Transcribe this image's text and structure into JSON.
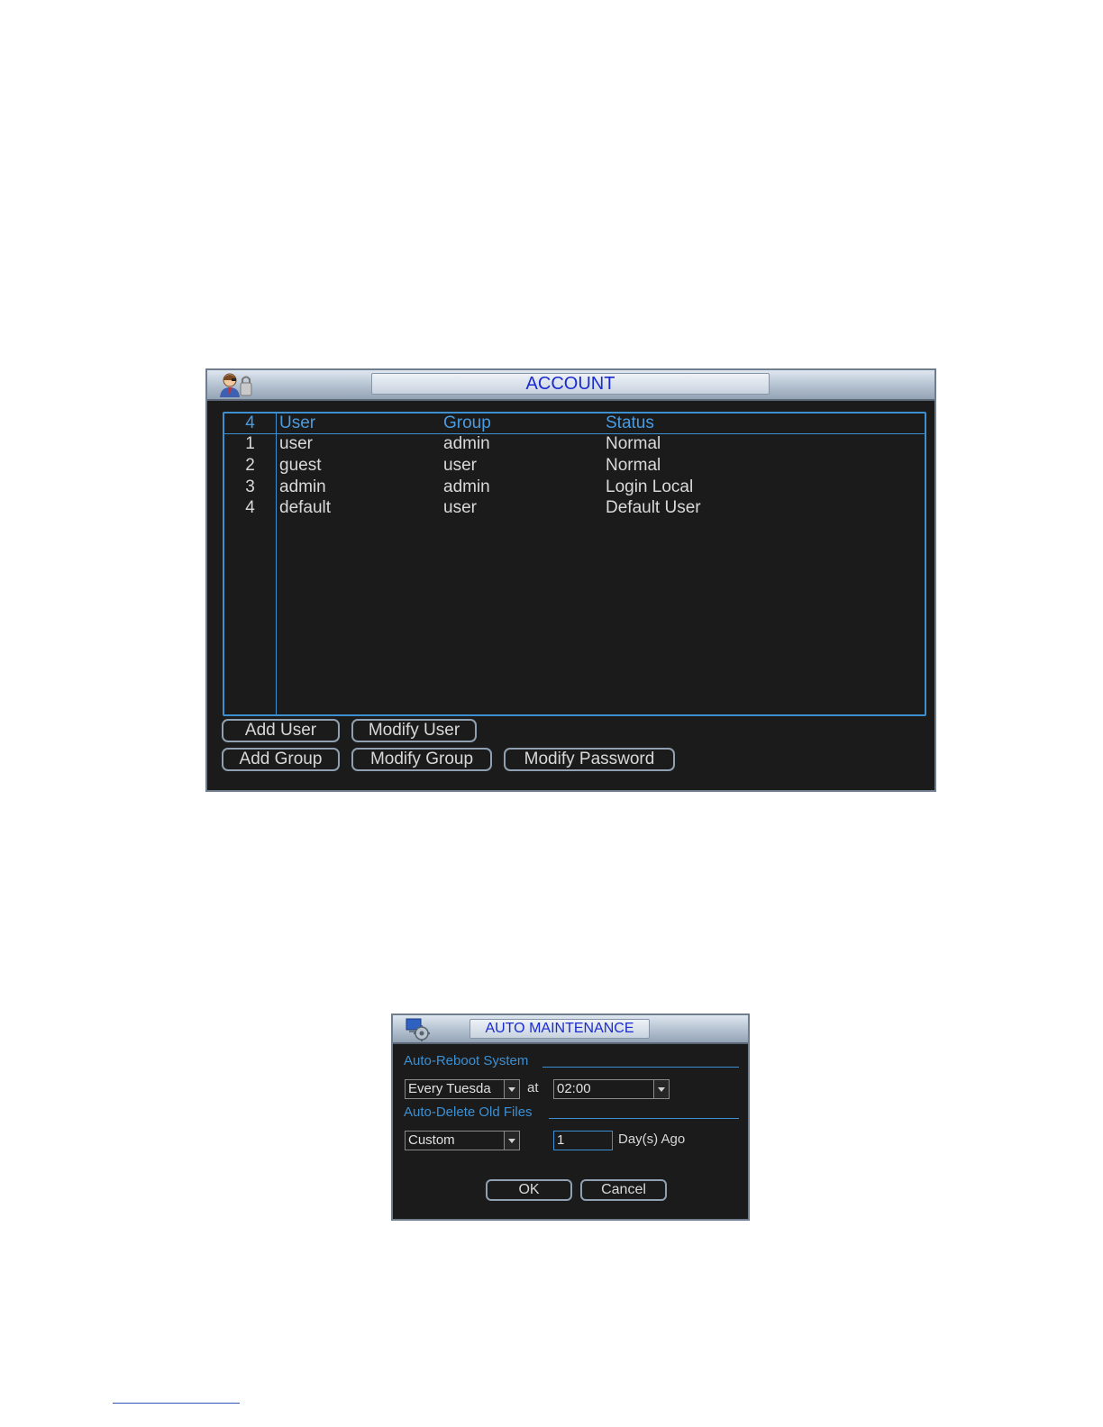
{
  "account": {
    "title": "ACCOUNT",
    "table": {
      "headers": {
        "count": "4",
        "user": "User",
        "group": "Group",
        "status": "Status"
      },
      "rows": [
        {
          "num": "1",
          "user": "user",
          "group": "admin",
          "status": "Normal"
        },
        {
          "num": "2",
          "user": "guest",
          "group": "user",
          "status": "Normal"
        },
        {
          "num": "3",
          "user": "admin",
          "group": "admin",
          "status": "Login Local"
        },
        {
          "num": "4",
          "user": "default",
          "group": "user",
          "status": "Default User"
        }
      ]
    },
    "buttons": {
      "add_user": "Add User",
      "modify_user": "Modify User",
      "add_group": "Add Group",
      "modify_group": "Modify Group",
      "modify_password": "Modify Password"
    },
    "icon": "user-account-icon"
  },
  "auto_maintenance": {
    "title": "AUTO MAINTENANCE",
    "icon": "maintenance-icon",
    "auto_reboot": {
      "label": "Auto-Reboot System",
      "day_value": "Every Tuesda",
      "at_label": "at",
      "time_value": "02:00"
    },
    "auto_delete": {
      "label": "Auto-Delete Old Files",
      "mode_value": "Custom",
      "days_value": "1",
      "days_suffix": "Day(s) Ago"
    },
    "buttons": {
      "ok": "OK",
      "cancel": "Cancel"
    }
  },
  "colors": {
    "window_bg": "#1b1b1b",
    "accent_blue": "#3e8fcf",
    "title_text": "#1a2bd0"
  }
}
